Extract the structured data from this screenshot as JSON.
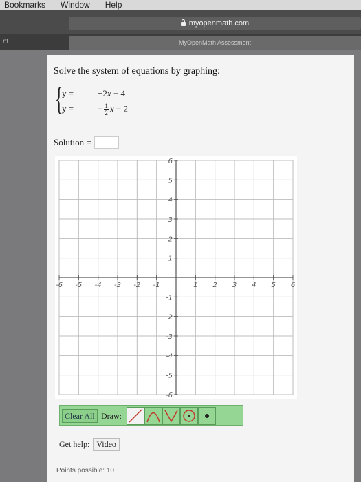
{
  "menubar": {
    "items": [
      "Bookmarks",
      "Window",
      "Help"
    ]
  },
  "browser": {
    "url": "myopenmath.com",
    "tab_left_label": "nt",
    "active_tab_title": "MyOpenMath Assessment"
  },
  "question": {
    "prompt": "Solve the system of equations by graphing:",
    "eq1": {
      "lhs": "y =",
      "coef": "−2",
      "var": "x",
      "rest": " + 4"
    },
    "eq2": {
      "lhs": "y =",
      "sign": "−",
      "frac_num": "1",
      "frac_den": "2",
      "var": "x",
      "rest": " − 2"
    },
    "solution_label": "Solution =",
    "solution_value": ""
  },
  "graph": {
    "x_ticks": [
      "-6",
      "-5",
      "-4",
      "-3",
      "-2",
      "-1",
      "1",
      "2",
      "3",
      "4",
      "5",
      "6"
    ],
    "y_ticks": [
      "6",
      "5",
      "4",
      "3",
      "2",
      "1",
      "-1",
      "-2",
      "-3",
      "-4",
      "-5",
      "-6"
    ],
    "colors": {
      "grid": "#bdbdbd",
      "axis": "#555555",
      "label": "#555555"
    }
  },
  "toolbar": {
    "clear_label": "Clear All",
    "draw_label": "Draw:",
    "tools": [
      "line-tool",
      "parabola-tool",
      "abs-value-tool",
      "circle-tool",
      "dot-tool"
    ],
    "active_tool": "line-tool",
    "accent_color": "#95d695"
  },
  "help": {
    "label": "Get help:",
    "video_label": "Video"
  },
  "footer": {
    "points": "Points possible: 10"
  }
}
